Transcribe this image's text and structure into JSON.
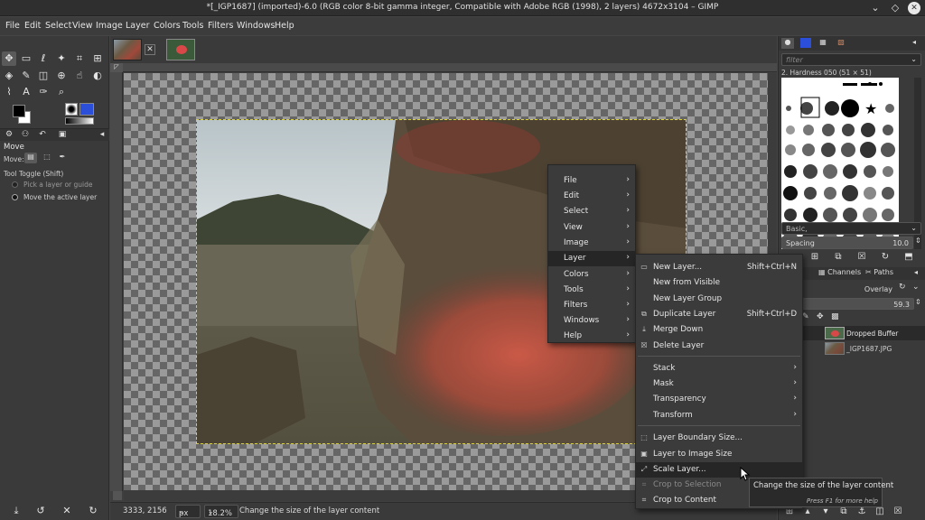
{
  "window": {
    "title": "*[_IGP1687] (imported)-6.0 (RGB color 8-bit gamma integer, Compatible with Adobe RGB (1998), 2 layers) 4672x3104 – GIMP"
  },
  "menubar": [
    "File",
    "Edit",
    "Select",
    "View",
    "Image",
    "Layer",
    "Colors",
    "Tools",
    "Filters",
    "Windows",
    "Help"
  ],
  "tool_options": {
    "title": "Move",
    "move_label": "Move:",
    "toggle_label": "Tool Toggle (Shift)",
    "option_pick": "Pick a layer or guide",
    "option_move": "Move the active layer"
  },
  "brushes": {
    "filter_placeholder": "filter",
    "brush_name": "2. Hardness 050 (51 × 51)",
    "preset": "Basic,",
    "spacing_label": "Spacing",
    "spacing_value": "10.0"
  },
  "layers": {
    "tabs": [
      "Channels",
      "Paths"
    ],
    "mode": "Overlay",
    "opacity": "59.3",
    "items": [
      "Dropped Buffer",
      "_IGP1687.JPG"
    ]
  },
  "status": {
    "coords": "3333, 2156",
    "unit": "px",
    "zoom": "18.2%",
    "message": "Change the size of the layer content"
  },
  "context_menu": {
    "items": [
      "File",
      "Edit",
      "Select",
      "View",
      "Image",
      "Layer",
      "Colors",
      "Tools",
      "Filters",
      "Windows",
      "Help"
    ],
    "highlighted": "Layer"
  },
  "layer_submenu": {
    "group1": [
      {
        "label": "New Layer...",
        "shortcut": "Shift+Ctrl+N",
        "icon": "new-layer-icon"
      },
      {
        "label": "New from Visible",
        "shortcut": "",
        "icon": ""
      },
      {
        "label": "New Layer Group",
        "shortcut": "",
        "icon": ""
      },
      {
        "label": "Duplicate Layer",
        "shortcut": "Shift+Ctrl+D",
        "icon": "duplicate-icon"
      },
      {
        "label": "Merge Down",
        "shortcut": "",
        "icon": "merge-icon"
      },
      {
        "label": "Delete Layer",
        "shortcut": "",
        "icon": "delete-icon"
      }
    ],
    "group2": [
      "Stack",
      "Mask",
      "Transparency",
      "Transform"
    ],
    "group3": [
      {
        "label": "Layer Boundary Size...",
        "disabled": false
      },
      {
        "label": "Layer to Image Size",
        "disabled": false
      },
      {
        "label": "Scale Layer...",
        "disabled": false
      },
      {
        "label": "Crop to Selection",
        "disabled": true
      },
      {
        "label": "Crop to Content",
        "disabled": false
      }
    ],
    "highlighted": "Scale Layer..."
  },
  "tooltip": {
    "text": "Change the size of the layer content",
    "hint": "Press F1 for more help"
  },
  "colors": {
    "menu_bg": "#3b3b3b",
    "highlight": "#262626",
    "accent_blue": "#2b4fd8"
  }
}
